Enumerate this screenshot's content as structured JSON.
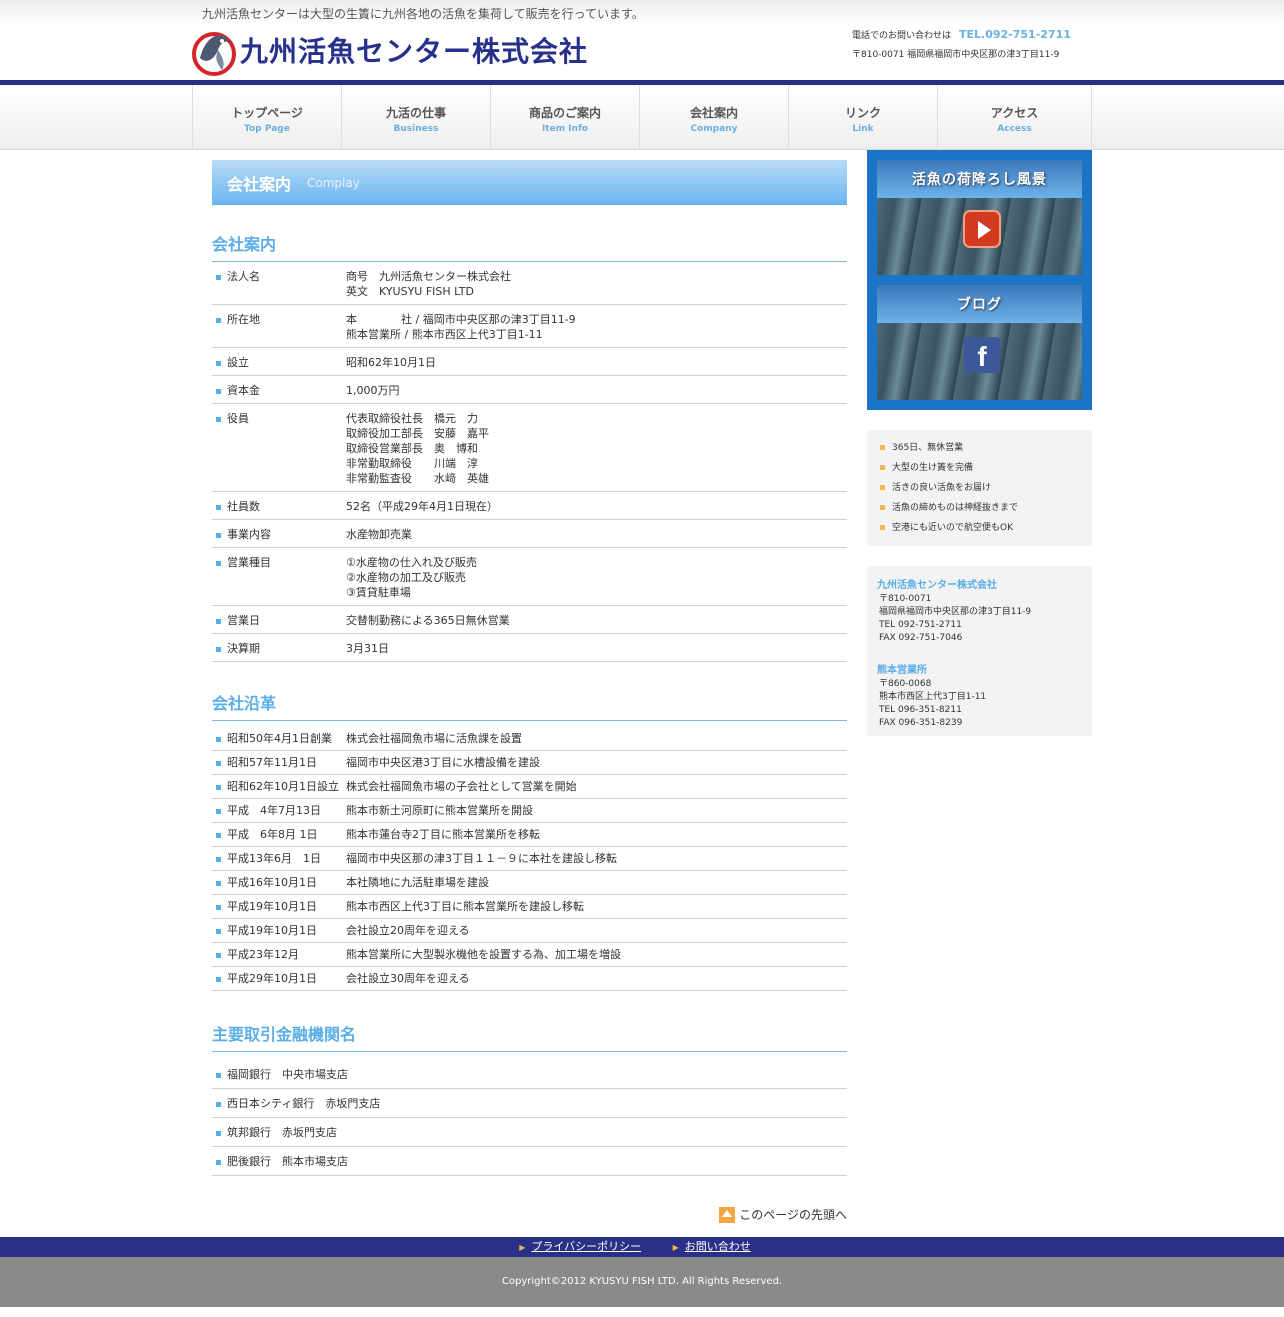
{
  "header": {
    "tagline": "九州活魚センターは大型の生簀に九州各地の活魚を集荷して販売を行っています。",
    "logo_text": "九州活魚センター株式会社",
    "contact_label": "電話でのお問い合わせは",
    "tel": "TEL.092-751-2711",
    "address": "〒810-0071 福岡県福岡市中央区那の津3丁目11-9"
  },
  "nav": [
    {
      "ja": "トップページ",
      "en": "Top Page"
    },
    {
      "ja": "九活の仕事",
      "en": "Business"
    },
    {
      "ja": "商品のご案内",
      "en": "Item Info"
    },
    {
      "ja": "会社案内",
      "en": "Company"
    },
    {
      "ja": "リンク",
      "en": "Link"
    },
    {
      "ja": "アクセス",
      "en": "Access"
    }
  ],
  "page_title": {
    "ja": "会社案内",
    "en": "Complay"
  },
  "profile": {
    "heading": "会社案内",
    "rows": [
      {
        "k": "法人名",
        "v": [
          "商号　九州活魚センター株式会社",
          "英文　KYUSYU FISH LTD"
        ]
      },
      {
        "k": "所在地",
        "v": [
          "本　　　　社 / 福岡市中央区那の津3丁目11-9",
          "熊本営業所 / 熊本市西区上代3丁目1-11"
        ]
      },
      {
        "k": "設立",
        "v": [
          "昭和62年10月1日"
        ]
      },
      {
        "k": "資本金",
        "v": [
          "1,000万円"
        ]
      },
      {
        "k": "役員",
        "v": [
          "代表取締役社長　橋元　力",
          "取締役加工部長　安藤　嘉平",
          "取締役営業部長　奥　博和",
          "非常勤取締役　　川端　淳",
          "非常勤監査役　　水﨑　英雄"
        ]
      },
      {
        "k": "社員数",
        "v": [
          "52名（平成29年4月1日現在）"
        ]
      },
      {
        "k": "事業内容",
        "v": [
          "水産物卸売業"
        ]
      },
      {
        "k": "営業種目",
        "v": [
          "①水産物の仕入れ及び販売",
          "②水産物の加工及び販売",
          "③賃貸駐車場"
        ]
      },
      {
        "k": "営業日",
        "v": [
          "交替制勤務による365日無休営業"
        ]
      },
      {
        "k": "決算期",
        "v": [
          "3月31日"
        ]
      }
    ]
  },
  "history": {
    "heading": "会社沿革",
    "rows": [
      {
        "k": "昭和50年4月1日創業",
        "v": "株式会社福岡魚市場に活魚課を設置"
      },
      {
        "k": "昭和57年11月1日",
        "v": "福岡市中央区港3丁目に水槽設備を建設"
      },
      {
        "k": "昭和62年10月1日設立",
        "v": "株式会社福岡魚市場の子会社として営業を開始"
      },
      {
        "k": "平成　4年7月13日",
        "v": "熊本市新土河原町に熊本営業所を開設"
      },
      {
        "k": "平成　6年8月 1日",
        "v": "熊本市蓮台寺2丁目に熊本営業所を移転"
      },
      {
        "k": "平成13年6月　1日",
        "v": "福岡市中央区那の津3丁目１１－９に本社を建設し移転"
      },
      {
        "k": "平成16年10月1日",
        "v": "本社隣地に九活駐車場を建設"
      },
      {
        "k": "平成19年10月1日",
        "v": "熊本市西区上代3丁目に熊本営業所を建設し移転"
      },
      {
        "k": "平成19年10月1日",
        "v": "会社設立20周年を迎える"
      },
      {
        "k": "平成23年12月",
        "v": "熊本営業所に大型製氷機他を設置する為、加工場を増設"
      },
      {
        "k": "平成29年10月1日",
        "v": "会社設立30周年を迎える"
      }
    ]
  },
  "banks": {
    "heading": "主要取引金融機関名",
    "rows": [
      "福岡銀行　中央市場支店",
      "西日本シティ銀行　赤坂門支店",
      "筑邦銀行　赤坂門支店",
      "肥後銀行　熊本市場支店"
    ]
  },
  "pagetop_label": "このページの先頭へ",
  "sidebar": {
    "banner1": "活魚の荷降ろし風景",
    "banner2": "ブログ",
    "features": [
      "365日、無休営業",
      "大型の生け簀を完備",
      "活きの良い活魚をお届け",
      "活魚の締めものは神経抜きまで",
      "空港にも近いので航空便もOK"
    ],
    "offices": [
      {
        "name": "九州活魚センター株式会社",
        "lines": [
          "〒810-0071",
          "福岡県福岡市中央区那の津3丁目11-9",
          "TEL 092-751-2711",
          "FAX 092-751-7046"
        ]
      },
      {
        "name": "熊本営業所",
        "lines": [
          "〒860-0068",
          "熊本市西区上代3丁目1-11",
          "TEL 096-351-8211",
          "FAX 096-351-8239"
        ]
      }
    ]
  },
  "footer": {
    "links": [
      "プライバシーポリシー",
      "お問い合わせ"
    ],
    "copyright": "Copyright©2012 KYUSYU FISH LTD. All Rights Reserved."
  }
}
